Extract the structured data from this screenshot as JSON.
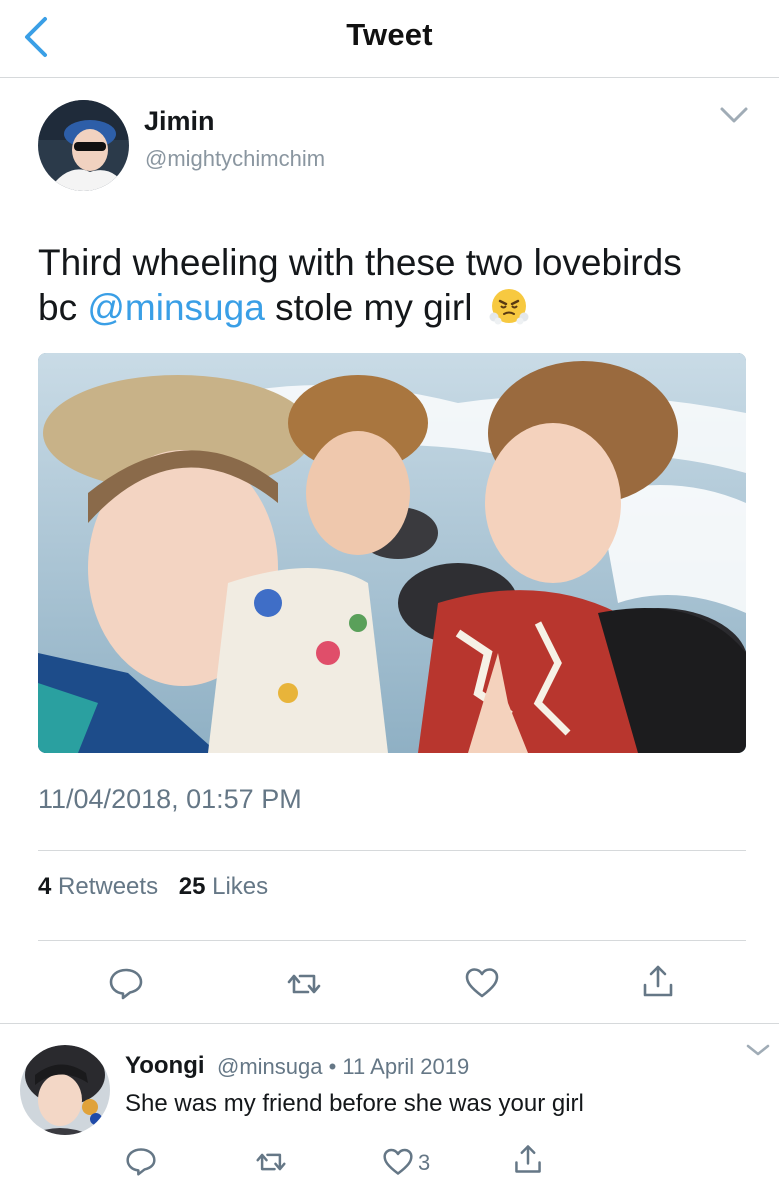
{
  "header": {
    "title": "Tweet"
  },
  "tweet": {
    "author_name": "Jimin",
    "author_handle": "@mightychimchim",
    "text_line1": "Third wheeling with these two lovebirds",
    "text_bc": "bc",
    "mention": "@minsuga",
    "text_tail": "stole my girl",
    "emoji": "face-with-steam-from-nose",
    "timestamp": "11/04/2018, 01:57 PM",
    "retweets_count": "4",
    "retweets_label": "Retweets",
    "likes_count": "25",
    "likes_label": "Likes"
  },
  "reply": {
    "author_name": "Yoongi",
    "meta": "@minsuga • 11 April 2019",
    "text": "She was my friend before she was your girl",
    "like_count": "3"
  },
  "colors": {
    "accent": "#3a9fe6",
    "text": "#14171a",
    "secondary": "#657786",
    "divider": "#d6d9db"
  },
  "icons": [
    "back-chevron-icon",
    "chevron-down-icon",
    "reply-icon",
    "retweet-icon",
    "like-icon",
    "share-icon"
  ]
}
